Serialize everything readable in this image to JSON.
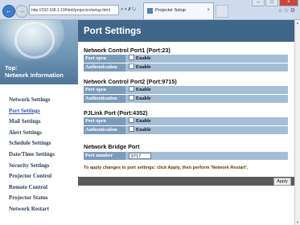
{
  "browser": {
    "url": "http://192.168.1.10/html/projector/setup.html",
    "address_tools": "⌕ ▾ ✗ ↻",
    "tab_title": "Projector Setup",
    "tab_close": "×",
    "right_icons": "⌂ ☆ ⚙",
    "back": "←",
    "forward": "→",
    "window_buttons": [
      "–",
      "□",
      "×"
    ]
  },
  "sidebar": {
    "banner_title": "Top:",
    "banner_subtitle": "Network Information",
    "items": [
      {
        "label": "Network Settings"
      },
      {
        "label": "Port Settings"
      },
      {
        "label": "Mail Settings"
      },
      {
        "label": "Alert Settings"
      },
      {
        "label": "Schedule Settings"
      },
      {
        "label": "Date/Time Settings"
      },
      {
        "label": "Security Settings"
      },
      {
        "label": "Projector Control"
      },
      {
        "label": "Remote Control"
      },
      {
        "label": "Projector Status"
      },
      {
        "label": "Network Restart"
      }
    ]
  },
  "main": {
    "title": "Port Settings",
    "sections": [
      {
        "title": "Network Control Port1 (Port:23)",
        "rows": [
          {
            "label": "Port open",
            "value": "Enable"
          },
          {
            "label": "Authentication",
            "value": "Enable"
          }
        ]
      },
      {
        "title": "Network Control Port2 (Port:9715)",
        "rows": [
          {
            "label": "Port open",
            "value": "Enable"
          },
          {
            "label": "Authentication",
            "value": "Enable"
          }
        ]
      },
      {
        "title": "PJLink Port (Port:4352)",
        "rows": [
          {
            "label": "Port open",
            "value": "Enable"
          },
          {
            "label": "Authentication",
            "value": "Enable"
          }
        ]
      }
    ],
    "bridge": {
      "title": "Network Bridge Port",
      "label": "Port number",
      "value": "9717"
    },
    "note": "To apply changes to port settings: click Apply, then perform 'Network Restart'.",
    "apply_label": "Apply"
  }
}
